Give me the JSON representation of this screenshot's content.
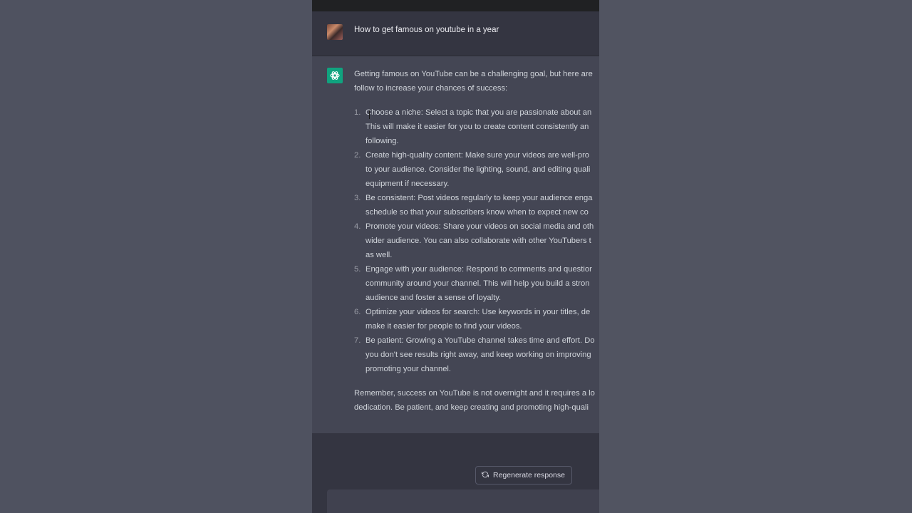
{
  "conversation": {
    "user_prompt": "How to get famous on youtube in a year",
    "assistant": {
      "intro_line1": "Getting famous on YouTube can be a challenging goal, but here are",
      "intro_line2": "follow to increase your chances of success:",
      "items": [
        {
          "num": "1.",
          "lines": [
            "Choose a niche: Select a topic that you are passionate about an",
            "This will make it easier for you to create content consistently an",
            "following."
          ]
        },
        {
          "num": "2.",
          "lines": [
            "Create high-quality content: Make sure your videos are well-pro",
            "to your audience. Consider the lighting, sound, and editing quali",
            "equipment if necessary."
          ]
        },
        {
          "num": "3.",
          "lines": [
            "Be consistent: Post videos regularly to keep your audience enga",
            "schedule so that your subscribers know when to expect new co"
          ]
        },
        {
          "num": "4.",
          "lines": [
            "Promote your videos: Share your videos on social media and oth",
            "wider audience. You can also collaborate with other YouTubers t",
            "as well."
          ]
        },
        {
          "num": "5.",
          "lines": [
            "Engage with your audience: Respond to comments and questior",
            "community around your channel. This will help you build a stron",
            "audience and foster a sense of loyalty."
          ]
        },
        {
          "num": "6.",
          "lines": [
            "Optimize your videos for search: Use keywords in your titles, de",
            "make it easier for people to find your videos."
          ]
        },
        {
          "num": "7.",
          "lines": [
            "Be patient: Growing a YouTube channel takes time and effort. Do",
            "you don't see results right away, and keep working on improving",
            "promoting your channel."
          ]
        }
      ],
      "outro_line1": "Remember, success on YouTube is not overnight and it requires a lo",
      "outro_line2": "dedication. Be patient, and keep creating and promoting high-quali"
    }
  },
  "footer": {
    "regenerate_label": "Regenerate response"
  },
  "icons": {
    "user_avatar": "avatar",
    "assistant": "openai-logo-icon",
    "regenerate": "refresh-icon"
  },
  "colors": {
    "accent": "#10a37f",
    "user_bg": "#343541",
    "assistant_bg": "#444654"
  }
}
